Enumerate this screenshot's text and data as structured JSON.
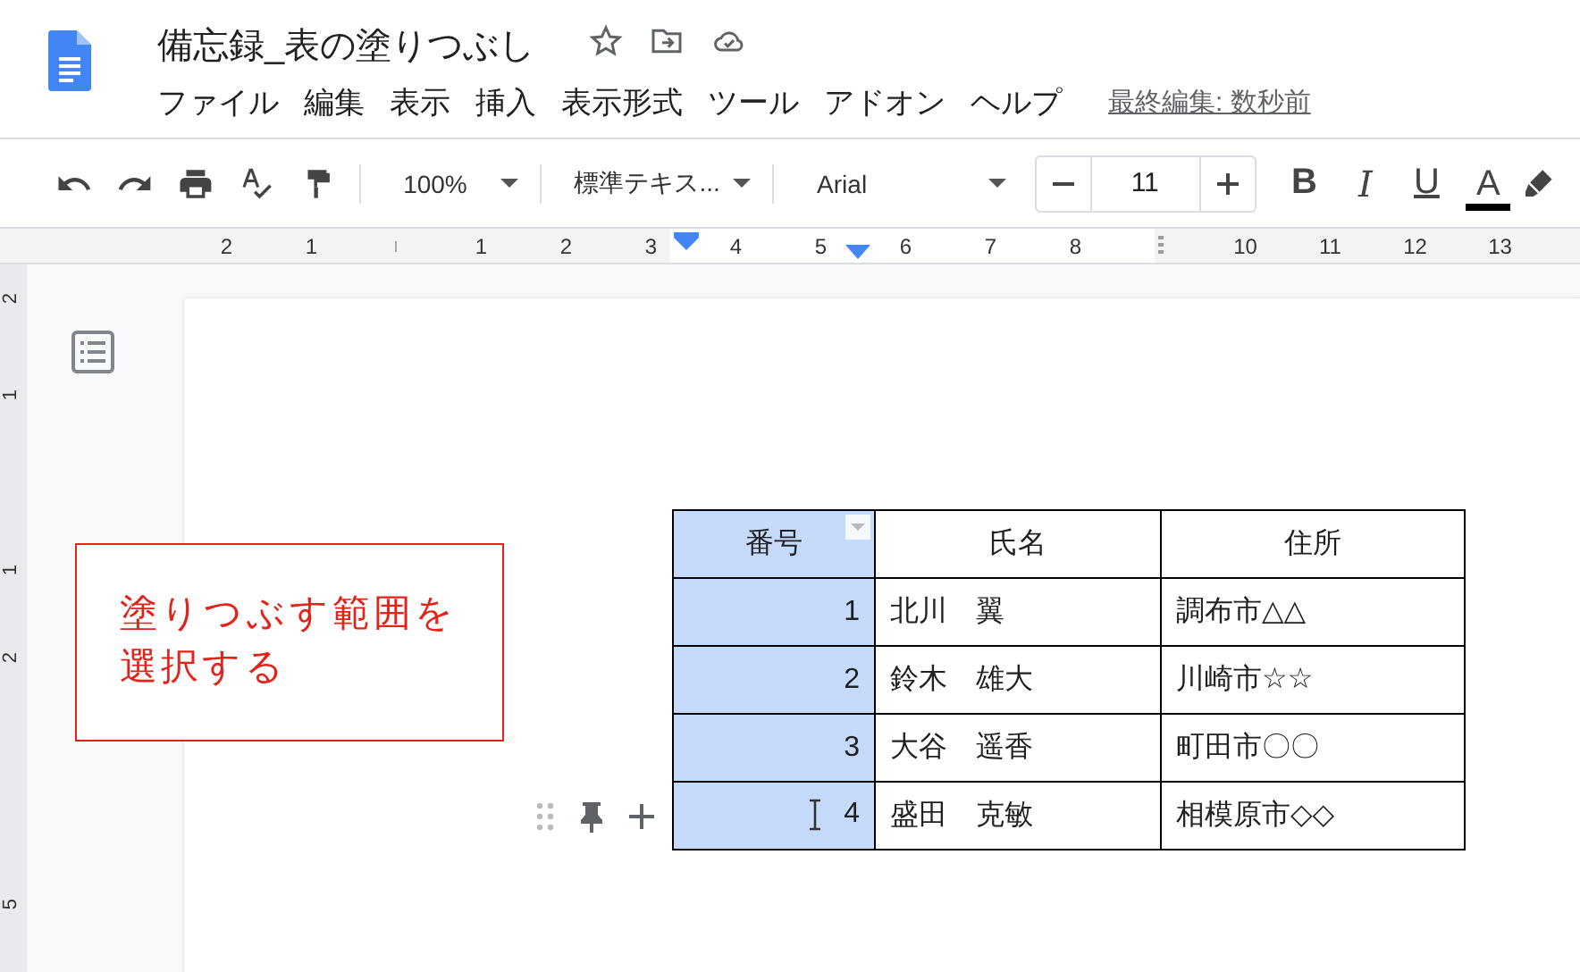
{
  "document": {
    "title": "備忘録_表の塗りつぶし"
  },
  "menu": [
    "ファイル",
    "編集",
    "表示",
    "挿入",
    "表示形式",
    "ツール",
    "アドオン",
    "ヘルプ"
  ],
  "last_edit": "最終編集: 数秒前",
  "toolbar": {
    "zoom": "100%",
    "style": "標準テキス...",
    "font": "Arial",
    "font_size": "11",
    "format_buttons": [
      {
        "kind": "bold",
        "label": "B"
      },
      {
        "kind": "italic",
        "label": "I"
      },
      {
        "kind": "underline",
        "label": "U"
      },
      {
        "kind": "color",
        "label": "A"
      }
    ]
  },
  "ruler": {
    "marks": [
      {
        "kind": "number",
        "label": "2"
      },
      {
        "kind": "number",
        "label": "1"
      },
      {
        "kind": "origin"
      },
      {
        "kind": "number",
        "label": "1"
      },
      {
        "kind": "number",
        "label": "2"
      },
      {
        "kind": "number",
        "label": "3"
      },
      {
        "kind": "number",
        "label": "4"
      },
      {
        "kind": "number",
        "label": "5"
      },
      {
        "kind": "number",
        "label": "6"
      },
      {
        "kind": "number",
        "label": "7"
      },
      {
        "kind": "number",
        "label": "8"
      },
      {
        "kind": "handle"
      },
      {
        "kind": "number",
        "label": "10"
      },
      {
        "kind": "number",
        "label": "11"
      },
      {
        "kind": "number",
        "label": "12"
      },
      {
        "kind": "number",
        "label": "13"
      }
    ]
  },
  "vertical_ruler": [
    "2",
    "1",
    "1",
    "2",
    "5"
  ],
  "text_box": {
    "text": "塗りつぶす範囲を選択する"
  },
  "table": {
    "header": [
      {
        "text": "番号",
        "selected": true
      },
      {
        "text": "氏名",
        "selected": false
      },
      {
        "text": "住所",
        "selected": false
      }
    ],
    "rows": [
      [
        {
          "text": "1",
          "selected": true
        },
        {
          "text": "北川　翼",
          "selected": false
        },
        {
          "text": "調布市△△",
          "selected": false
        }
      ],
      [
        {
          "text": "2",
          "selected": true
        },
        {
          "text": "鈴木　雄大",
          "selected": false
        },
        {
          "text": "川崎市☆☆",
          "selected": false
        }
      ],
      [
        {
          "text": "3",
          "selected": true
        },
        {
          "text": "大谷　遥香",
          "selected": false
        },
        {
          "text": "町田市〇〇",
          "selected": false
        }
      ],
      [
        {
          "text": "4",
          "selected": true
        },
        {
          "text": "盛田　克敏",
          "selected": false
        },
        {
          "text": "相模原市◇◇",
          "selected": false
        }
      ]
    ]
  }
}
